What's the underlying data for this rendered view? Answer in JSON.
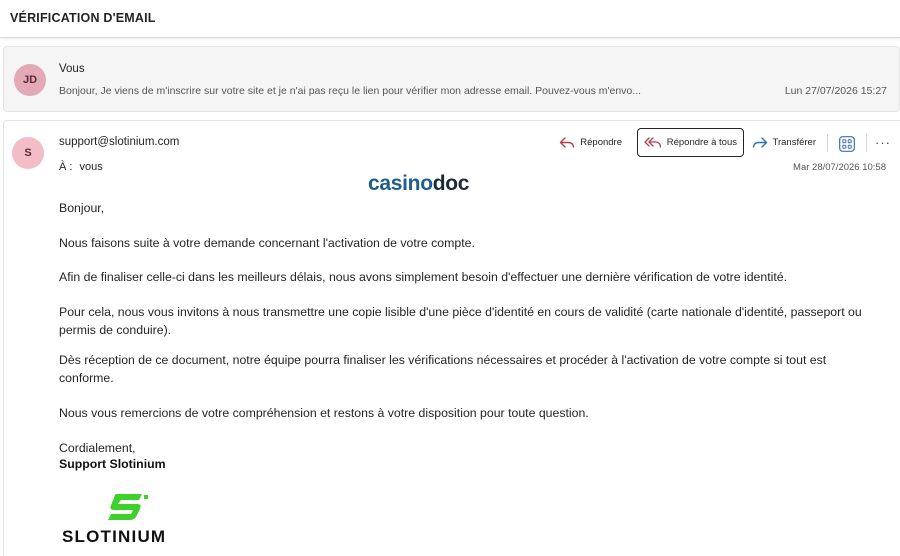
{
  "header": {
    "title": "VÉRIFICATION D'EMAIL"
  },
  "preview": {
    "avatar_initials": "JD",
    "sender": "Vous",
    "snippet": "Bonjour, Je viens de m'inscrire sur votre site et je n'ai pas reçu le lien pour vérifier mon adresse email. Pouvez-vous m'envo...",
    "date": "Lun 27/07/2026 15:27"
  },
  "message": {
    "avatar_initials": "S",
    "sender": "support@slotinium.com",
    "to_label": "À :",
    "to_value": "vous",
    "date": "Mar 28/07/2026 10:58",
    "actions": {
      "reply": "Répondre",
      "reply_all": "Répondre à tous",
      "forward": "Transférer",
      "more": "···"
    },
    "logo": {
      "part1": "casino",
      "part2": "doc"
    },
    "greeting": "Bonjour,",
    "paragraphs": [
      "Nous faisons suite à votre demande concernant l'activation de votre compte.",
      "Afin de finaliser celle-ci dans les meilleurs délais, nous avons simplement besoin d'effectuer une dernière vérification de votre identité.",
      "Pour cela, nous vous invitons à nous transmettre une copie lisible d'une pièce d'identité en cours de validité (carte nationale d'identité, passeport ou permis de conduire).",
      "Dès réception de ce document, notre équipe pourra finaliser les vérifications nécessaires et procéder à l'activation de votre compte si tout est conforme.",
      "Nous vous remercions de votre compréhension et restons à votre disposition pour toute question."
    ],
    "closing": "Cordialement,",
    "signature": "Support Slotinium",
    "brand_logo_text": "SLOTINIUM"
  },
  "colors": {
    "avatar_jd": "#e3a9b6",
    "avatar_s": "#f3bcc6",
    "reply_icon": "#b0404f",
    "forward_icon": "#2f6fb3",
    "apps_icon": "#3b6fb0",
    "slotinium_green": "#3fd12b"
  },
  "icons": [
    "reply-icon",
    "reply-all-icon",
    "forward-icon",
    "apps-icon",
    "more-icon"
  ]
}
